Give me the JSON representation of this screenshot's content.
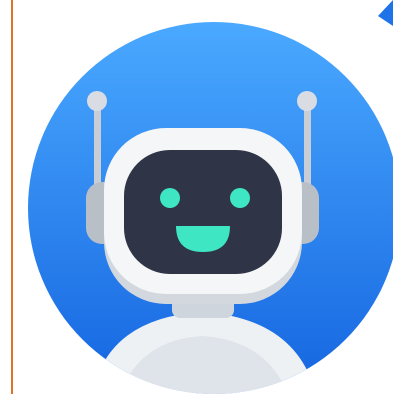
{
  "image": {
    "subject": "robot-avatar",
    "icons": [
      "robot-icon",
      "circle-background",
      "antenna-icon",
      "smile-icon"
    ],
    "colors": {
      "background": "#ffffff",
      "circle_top": "#4aa9ff",
      "circle_bottom": "#1565e0",
      "border_line": "#e0702a",
      "head_white": "#f4f6f8",
      "head_shadow": "#d3d8de",
      "face_screen": "#2f3446",
      "eyes_mouth": "#3ee6c4",
      "antenna_gray": "#c9ced6",
      "antenna_ball": "#d9dde3",
      "ear_gray": "#b9bfc7",
      "body_white": "#eef1f4",
      "corner_arrow": "#1e73e8"
    }
  }
}
